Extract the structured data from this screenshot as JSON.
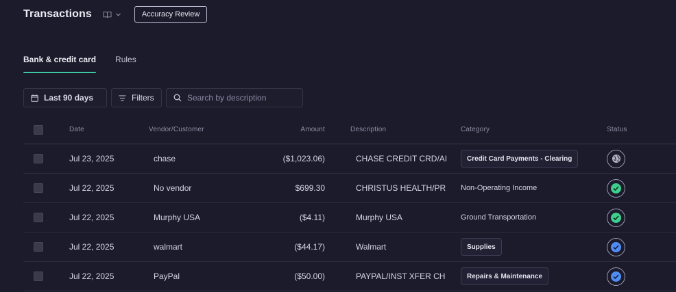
{
  "header": {
    "title": "Transactions",
    "review_button": "Accuracy Review"
  },
  "tabs": [
    {
      "label": "Bank & credit card",
      "active": true
    },
    {
      "label": "Rules",
      "active": false
    }
  ],
  "toolbar": {
    "date_range": "Last 90 days",
    "filters": "Filters",
    "search_placeholder": "Search by description",
    "search_value": ""
  },
  "table": {
    "columns": {
      "date": "Date",
      "vendor": "Vendor/Customer",
      "amount": "Amount",
      "description": "Description",
      "category": "Category",
      "status": "Status"
    },
    "rows": [
      {
        "date": "Jul 23, 2025",
        "vendor": "chase",
        "amount": "($1,023.06)",
        "description": "CHASE CREDIT CRD/AI",
        "category": "Credit Card Payments - Clearing",
        "category_style": "chip",
        "status": "world-icon"
      },
      {
        "date": "Jul 22, 2025",
        "vendor": "No vendor",
        "amount": "$699.30",
        "description": "CHRISTUS HEALTH/PR",
        "category": "Non-Operating Income",
        "category_style": "plain",
        "status": "check-green"
      },
      {
        "date": "Jul 22, 2025",
        "vendor": "Murphy USA",
        "amount": "($4.11)",
        "description": "Murphy USA",
        "category": "Ground Transportation",
        "category_style": "plain",
        "status": "check-green"
      },
      {
        "date": "Jul 22, 2025",
        "vendor": "walmart",
        "amount": "($44.17)",
        "description": "Walmart",
        "category": "Supplies",
        "category_style": "chip",
        "status": "check-blue"
      },
      {
        "date": "Jul 22, 2025",
        "vendor": "PayPal",
        "amount": "($50.00)",
        "description": "PAYPAL/INST XFER CH",
        "category": "Repairs & Maintenance",
        "category_style": "chip",
        "status": "check-blue"
      }
    ]
  },
  "colors": {
    "background": "#1c1b2b",
    "tab_underline": "#3fc7a4",
    "status_green": "#3ecf8e",
    "status_blue": "#4f8df5"
  }
}
